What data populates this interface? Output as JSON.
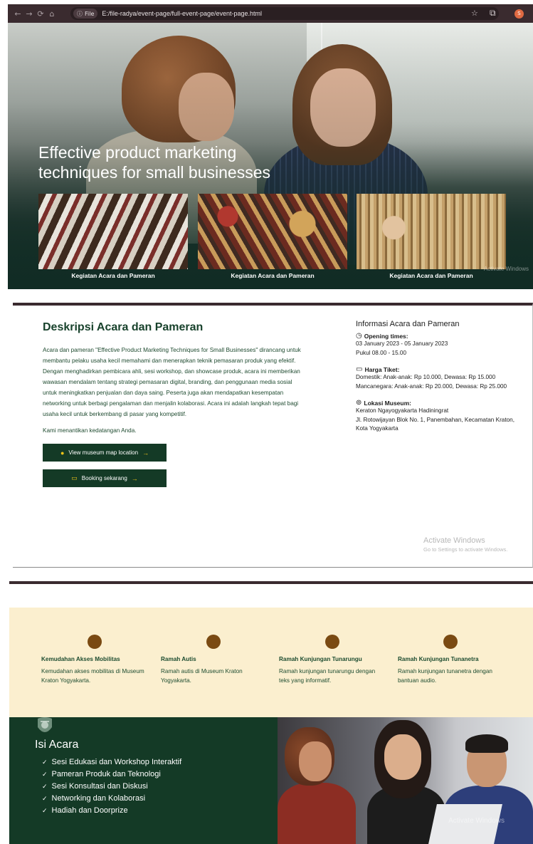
{
  "browser": {
    "nav_back": "←",
    "nav_forward": "→",
    "nav_reload": "⟳",
    "nav_home": "⌂",
    "chip_label": "File",
    "url": "E:/file-radya/event-page/full-event-page/event-page.html",
    "star": "☆",
    "extensions": "⧉",
    "avatar_letter": "S"
  },
  "hero": {
    "title": "Effective product marketing techniques for small businesses",
    "gallery": [
      {
        "caption": "Kegiatan Acara dan Pameran"
      },
      {
        "caption": "Kegiatan Acara dan Pameran"
      },
      {
        "caption": "Kegiatan Acara dan Pameran"
      }
    ],
    "watermark": "Activate Windows"
  },
  "description": {
    "title": "Deskripsi Acara dan Pameran",
    "body": "Acara dan pameran \"Effective Product Marketing Techniques for Small Businesses\" dirancang untuk membantu pelaku usaha kecil memahami dan menerapkan teknik pemasaran produk yang efektif. Dengan menghadirkan pembicara ahli, sesi workshop, dan showcase produk, acara ini memberikan wawasan mendalam tentang strategi pemasaran digital, branding, dan penggunaan media sosial untuk meningkatkan penjualan dan daya saing. Peserta juga akan mendapatkan kesempatan networking untuk berbagi pengalaman dan menjalin kolaborasi. Acara ini adalah langkah tepat bagi usaha kecil untuk berkembang di pasar yang kompetitif.",
    "invite": "Kami menantikan kedatangan Anda.",
    "map_button": "View museum map location",
    "booking_button": "Booking sekarang",
    "arrow": "→"
  },
  "info": {
    "title": "Informasi Acara dan Pameran",
    "opening_label": "Opening times:",
    "opening_dates": "03 January 2023 - 05 January 2023",
    "opening_hours": "Pukul 08.00 - 15.00",
    "ticket_label": "Harga Tiket:",
    "ticket_domestic": "Domestik: Anak-anak: Rp 10.000, Dewasa: Rp 15.000",
    "ticket_foreign": "Mancanegara: Anak-anak: Rp 20.000, Dewasa: Rp 25.000",
    "location_label": "Lokasi Museum:",
    "location_line1": "Keraton Ngayogyakarta Hadiningrat",
    "location_line2": "Jl. Rotowijayan Blok No. 1, Panembahan, Kecamatan Kraton, Kota Yogyakarta"
  },
  "activate": {
    "line1": "Activate Windows",
    "line2": "Go to Settings to activate Windows."
  },
  "accessibility": [
    {
      "title": "Kemudahan Akses Mobilitas",
      "desc": "Kemudahan akses mobilitas di Museum Kraton Yogyakarta."
    },
    {
      "title": "Ramah Autis",
      "desc": "Ramah autis di Museum Kraton Yogyakarta."
    },
    {
      "title": "Ramah Kunjungan Tunarungu",
      "desc": "Ramah kunjungan tunarungu dengan teks yang informatif."
    },
    {
      "title": "Ramah Kunjungan Tunanetra",
      "desc": "Ramah kunjungan tunanetra dengan bantuan audio."
    }
  ],
  "program": {
    "title": "Isi Acara",
    "items": [
      "Sesi Edukasi dan Workshop Interaktif",
      "Pameran Produk dan Teknologi",
      "Sesi Konsultasi dan Diskusi",
      "Networking dan Kolaborasi",
      "Hadiah dan Doorprize"
    ],
    "check": "✓",
    "watermark": "Activate Windows"
  },
  "colors": {
    "brand_green": "#143a26",
    "accent_yellow": "#f0c419",
    "cream": "#fbefcf",
    "dot_brown": "#7a4a12"
  }
}
